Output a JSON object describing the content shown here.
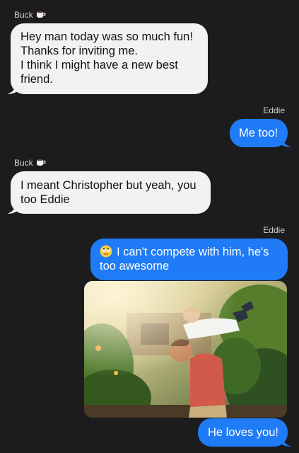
{
  "conversation": {
    "messages": [
      {
        "sender": "Buck",
        "side": "left",
        "lines": [
          "Hey man today was so much fun!",
          "Thanks for inviting me.",
          "I think I might have a new best",
          "friend."
        ]
      },
      {
        "sender": "Eddie",
        "side": "right",
        "lines": [
          "Me too!"
        ]
      },
      {
        "sender": "Buck",
        "side": "left",
        "lines": [
          "I meant Christopher but yeah, you",
          "too Eddie"
        ]
      },
      {
        "sender": "Eddie",
        "side": "right",
        "emoji": "rolling-eyes-emoji",
        "lines": [
          "I can't compete with him, he's",
          "too awesome"
        ]
      },
      {
        "sender": "Eddie",
        "side": "right",
        "attachment": "photo",
        "lines": [
          "He loves you!"
        ]
      }
    ],
    "sender_icons": {
      "Buck": "coffee-cup-icon"
    }
  },
  "colors": {
    "background": "#1c1c1e",
    "incoming_bubble": "#f2f2f2",
    "outgoing_bubble": "#1f7bf6",
    "sender_label": "#d0d0d0"
  }
}
